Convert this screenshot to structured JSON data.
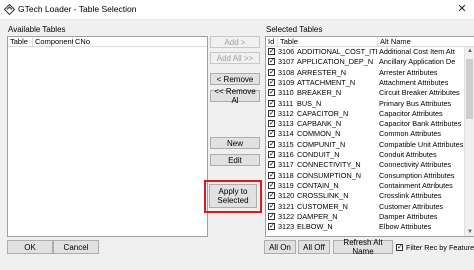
{
  "window": {
    "title": "GTech Loader - Table Selection",
    "close_glyph": "✕"
  },
  "available": {
    "label": "Available Tables",
    "columns": [
      "Table",
      "Component",
      "CNo"
    ]
  },
  "middle_buttons": {
    "add": "Add >",
    "add_all": "Add All >>",
    "remove": "< Remove",
    "remove_all": "<< Remove Al",
    "new": "New",
    "edit": "Edit",
    "apply": "Apply to\nSelected"
  },
  "selected": {
    "label": "Selected Tables",
    "columns": [
      "Id",
      "Table",
      "Alt Name"
    ],
    "rows": [
      {
        "id": "3106",
        "table": "ADDITIONAL_COST_ITEM_N",
        "alt": "Additional Cost Item Att",
        "checked": true
      },
      {
        "id": "3107",
        "table": "APPLICATION_DEP_N",
        "alt": "Ancillary Application De",
        "checked": true
      },
      {
        "id": "3108",
        "table": "ARRESTER_N",
        "alt": "Arrester Attributes",
        "checked": true
      },
      {
        "id": "3109",
        "table": "ATTACHMENT_N",
        "alt": "Attachment Attributes",
        "checked": true
      },
      {
        "id": "3110",
        "table": "BREAKER_N",
        "alt": "Circuit Breaker Attributes",
        "checked": true
      },
      {
        "id": "3111",
        "table": "BUS_N",
        "alt": "Primary Bus Attributes",
        "checked": true
      },
      {
        "id": "3112",
        "table": "CAPACITOR_N",
        "alt": "Capacitor Attributes",
        "checked": true
      },
      {
        "id": "3113",
        "table": "CAPBANK_N",
        "alt": "Capacitor Bank Attributes",
        "checked": true
      },
      {
        "id": "3114",
        "table": "COMMON_N",
        "alt": "Common Attributes",
        "checked": true
      },
      {
        "id": "3115",
        "table": "COMPUNIT_N",
        "alt": "Compatible Unit Attributes",
        "checked": true
      },
      {
        "id": "3116",
        "table": "CONDUIT_N",
        "alt": "Conduit Attributes",
        "checked": true
      },
      {
        "id": "3117",
        "table": "CONNECTIVITY_N",
        "alt": "Connectivity Attributes",
        "checked": true
      },
      {
        "id": "3118",
        "table": "CONSUMPTION_N",
        "alt": "Consumption Attributes",
        "checked": true
      },
      {
        "id": "3119",
        "table": "CONTAIN_N",
        "alt": "Containment Attributes",
        "checked": true
      },
      {
        "id": "3120",
        "table": "CROSSLINK_N",
        "alt": "Crosslink Attributes",
        "checked": true
      },
      {
        "id": "3121",
        "table": "CUSTOMER_N",
        "alt": "Customer Attributes",
        "checked": true
      },
      {
        "id": "3122",
        "table": "DAMPER_N",
        "alt": "Damper Attributes",
        "checked": true
      },
      {
        "id": "3123",
        "table": "ELBOW_N",
        "alt": "Elbow Attributes",
        "checked": true
      }
    ]
  },
  "bottom": {
    "ok": "OK",
    "cancel": "Cancel",
    "all_on": "All On",
    "all_off": "All Off",
    "refresh": "Refresh Alt Name",
    "filter": "Filter Rec by Feature",
    "filter_checked": true
  },
  "colors": {
    "highlight": "#d71920",
    "window_bg": "#f0f0f0"
  }
}
